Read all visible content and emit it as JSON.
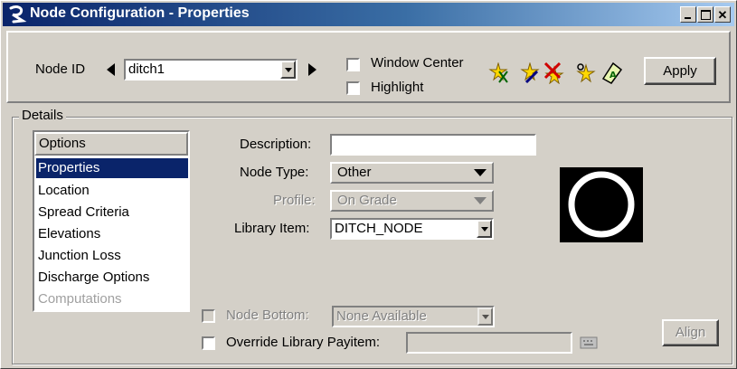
{
  "window": {
    "title": "Node Configuration - Properties"
  },
  "toolbar": {
    "node_id_label": "Node ID",
    "node_id_value": "ditch1",
    "window_center_label": "Window Center",
    "highlight_label": "Highlight",
    "apply_label": "Apply",
    "icons": [
      "add-node-icon",
      "edit-node-icon",
      "delete-node-icon",
      "locate-node-icon",
      "annotate-node-icon"
    ]
  },
  "details": {
    "group_label": "Details",
    "options_header": "Options",
    "options": [
      "Properties",
      "Location",
      "Spread Criteria",
      "Elevations",
      "Junction Loss",
      "Discharge Options",
      "Computations"
    ],
    "selected_option": "Properties",
    "description_label": "Description:",
    "description_value": "",
    "node_type_label": "Node Type:",
    "node_type_value": "Other",
    "profile_label": "Profile:",
    "profile_value": "On Grade",
    "library_item_label": "Library Item:",
    "library_item_value": "DITCH_NODE",
    "node_bottom_label": "Node Bottom:",
    "node_bottom_value": "None Available",
    "override_payitem_label": "Override Library Payitem:",
    "override_payitem_value": "",
    "align_label": "Align"
  }
}
